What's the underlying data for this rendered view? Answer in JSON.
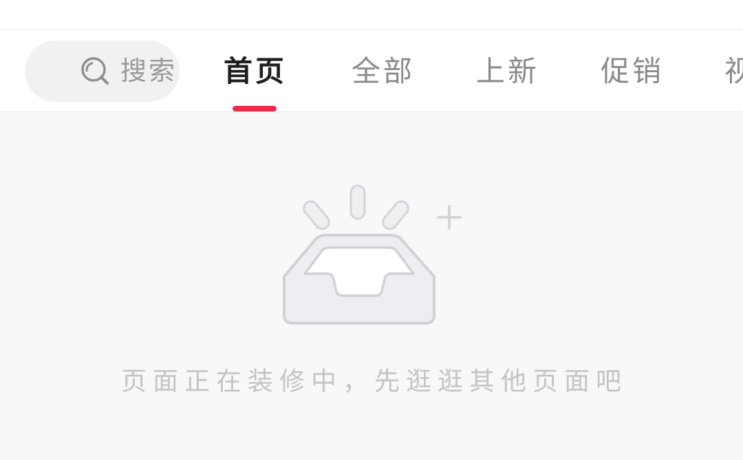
{
  "header": {
    "search": {
      "label": "搜索",
      "icon": "search-icon"
    },
    "tabs": [
      {
        "label": "首页",
        "active": true
      },
      {
        "label": "全部",
        "active": false
      },
      {
        "label": "上新",
        "active": false
      },
      {
        "label": "促销",
        "active": false
      },
      {
        "label": "视",
        "active": false
      }
    ],
    "accent_color": "#f0284a"
  },
  "empty_state": {
    "icon": "empty-inbox-icon",
    "message": "页面正在装修中，先逛逛其他页面吧"
  }
}
